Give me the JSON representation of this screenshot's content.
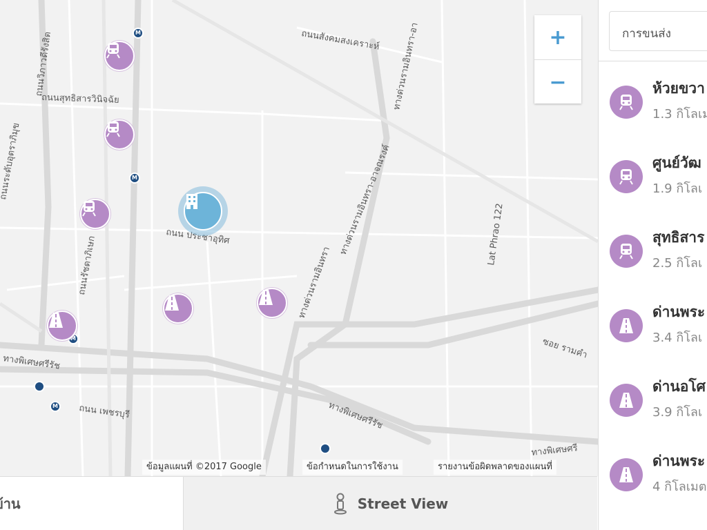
{
  "map": {
    "road_labels": [
      "ถนนสังคมสงเคราะห์",
      "ถนนสุทธิสารวินิจฉัย",
      "ทางด่วนรามอินทรา-อา",
      "ทางด่วนรามอินทรา-อาจณรงค์",
      "ถนน ประชาอุทิศ",
      "ถนนรัชดาภิเษก",
      "ทางด่วนรามอินทรา",
      "ถนนระดับอุตราภิมุข",
      "ถนนวิภาวดีรังสิต",
      "ทางพิเศษศรีรัช",
      "ถนน เพชรบุรี",
      "ทางพิเศษศรีรัช",
      "Lat Phrao 122",
      "ซอย รามคำ",
      "ทางพิเศษศรี"
    ],
    "zoom_in": "+",
    "zoom_out": "−",
    "attribution": {
      "data": "ข้อมูลแผนที่ ©2017 Google",
      "terms": "ข้อกำหนดในการใช้งาน",
      "report": "รายงานข้อผิดพลาดของแผนที่"
    }
  },
  "bottom_tabs": {
    "left_label": "บ้าน",
    "street_view": "Street View"
  },
  "sidebar": {
    "select_value": "การขนส่ง",
    "items": [
      {
        "name": "ห้วยขวา",
        "distance": "1.3 กิโลเม",
        "icon": "train-icon"
      },
      {
        "name": "ศูนย์วัฒ",
        "distance": "1.9 กิโลเ",
        "icon": "train-icon"
      },
      {
        "name": "สุทธิสาร",
        "distance": "2.5 กิโลเ",
        "icon": "train-icon"
      },
      {
        "name": "ด่านพระ",
        "distance": "3.4 กิโลเ",
        "icon": "toll-road-icon"
      },
      {
        "name": "ด่านอโศ",
        "distance": "3.9 กิโลเ",
        "icon": "toll-road-icon"
      },
      {
        "name": "ด่านพระ",
        "distance": "4 กิโลเมต",
        "icon": "toll-road-icon"
      }
    ]
  },
  "colors": {
    "poi": "#b58ac6",
    "hotel": "#6db4d9",
    "accent": "#4a9bd1",
    "metro": "#1f4e82"
  }
}
